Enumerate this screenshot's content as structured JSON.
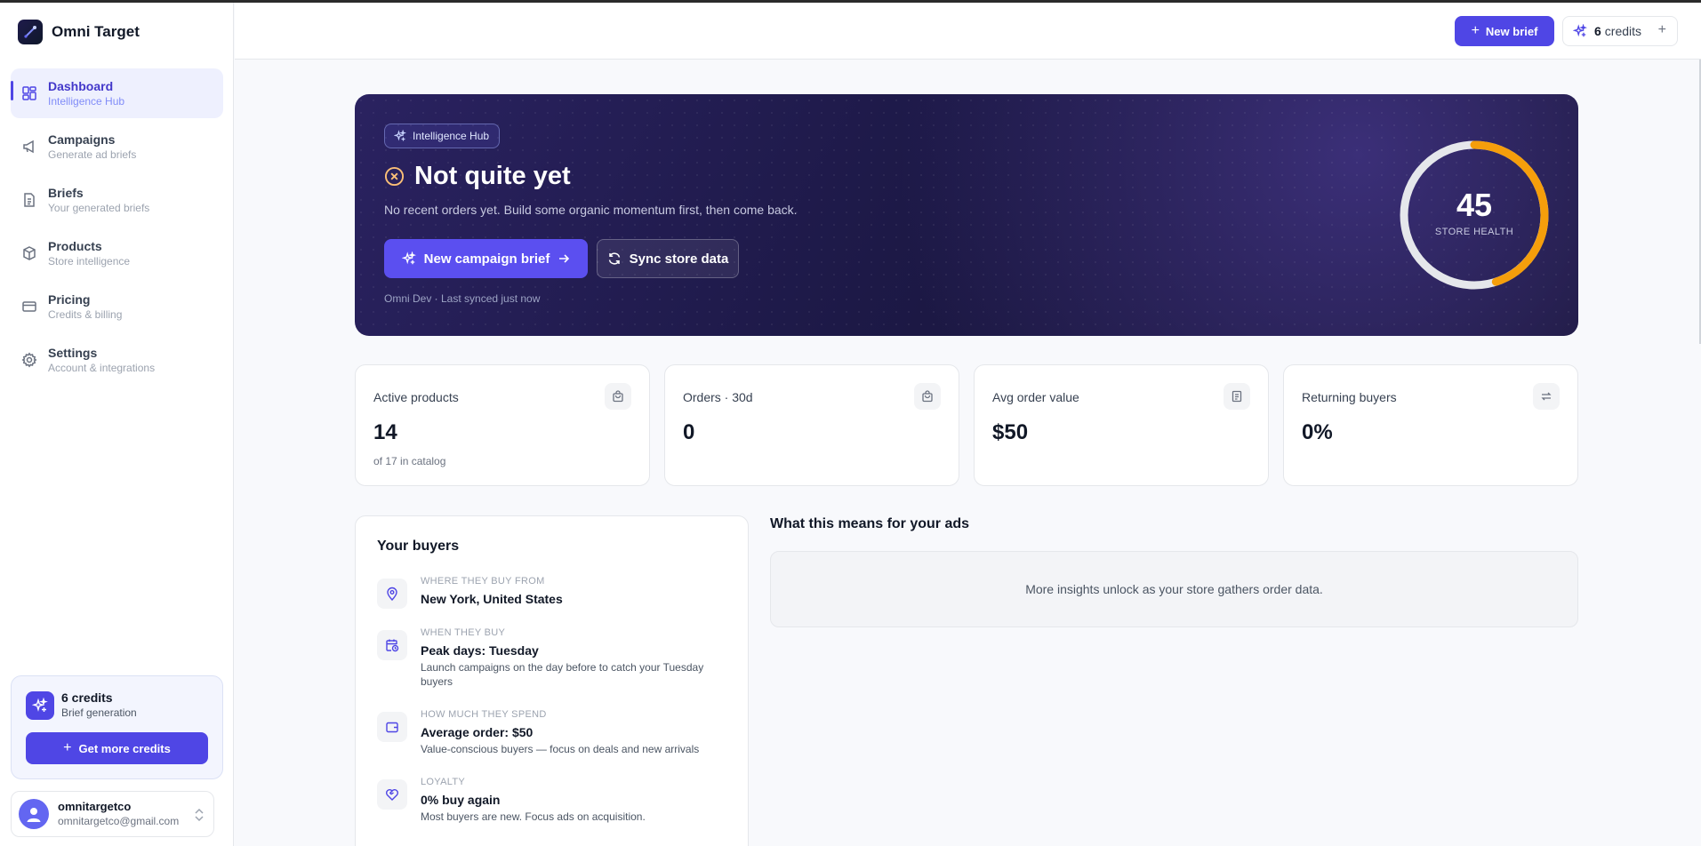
{
  "app": {
    "name": "Omni Target"
  },
  "sidebar": {
    "items": [
      {
        "label": "Dashboard",
        "sub": "Intelligence Hub",
        "icon": "dashboard-icon",
        "active": true
      },
      {
        "label": "Campaigns",
        "sub": "Generate ad briefs",
        "icon": "megaphone-icon"
      },
      {
        "label": "Briefs",
        "sub": "Your generated briefs",
        "icon": "document-icon"
      },
      {
        "label": "Products",
        "sub": "Store intelligence",
        "icon": "box-icon"
      },
      {
        "label": "Pricing",
        "sub": "Credits & billing",
        "icon": "credit-card-icon"
      },
      {
        "label": "Settings",
        "sub": "Account & integrations",
        "icon": "gear-icon"
      }
    ],
    "credits": {
      "title": "6 credits",
      "sub": "Brief generation",
      "button": "Get more credits"
    },
    "user": {
      "name": "omnitargetco",
      "email": "omnitargetco@gmail.com"
    }
  },
  "header": {
    "new_brief": "New brief",
    "credits_count": "6",
    "credits_label": "credits"
  },
  "hero": {
    "badge": "Intelligence Hub",
    "title": "Not quite yet",
    "description": "No recent orders yet. Build some organic momentum first, then come back.",
    "primary_button": "New campaign brief",
    "secondary_button": "Sync store data",
    "meta": "Omni Dev · Last synced just now",
    "score": "45",
    "score_label": "STORE HEALTH",
    "score_fraction": 0.45,
    "accent": "#f59e0b"
  },
  "stats": [
    {
      "label": "Active products",
      "value": "14",
      "sub": "of 17 in catalog",
      "icon": "shopping-bag-icon"
    },
    {
      "label": "Orders · 30d",
      "value": "0",
      "sub": "",
      "icon": "shopping-bag-icon"
    },
    {
      "label": "Avg order value",
      "value": "$50",
      "sub": "",
      "icon": "receipt-icon"
    },
    {
      "label": "Returning buyers",
      "value": "0%",
      "sub": "",
      "icon": "repeat-icon"
    }
  ],
  "buyers": {
    "title": "Your buyers",
    "rows": [
      {
        "kicker": "WHERE THEY BUY FROM",
        "title": "New York, United States",
        "desc": "",
        "icon": "map-pin-icon"
      },
      {
        "kicker": "WHEN THEY BUY",
        "title": "Peak days: Tuesday",
        "desc": "Launch campaigns on the day before to catch your Tuesday buyers",
        "icon": "calendar-clock-icon"
      },
      {
        "kicker": "HOW MUCH THEY SPEND",
        "title": "Average order: $50",
        "desc": "Value-conscious buyers — focus on deals and new arrivals",
        "icon": "wallet-icon"
      },
      {
        "kicker": "LOYALTY",
        "title": "0% buy again",
        "desc": "Most buyers are new. Focus ads on acquisition.",
        "icon": "heart-handshake-icon"
      }
    ]
  },
  "insights": {
    "title": "What this means for your ads",
    "empty": "More insights unlock as your store gathers order data."
  }
}
